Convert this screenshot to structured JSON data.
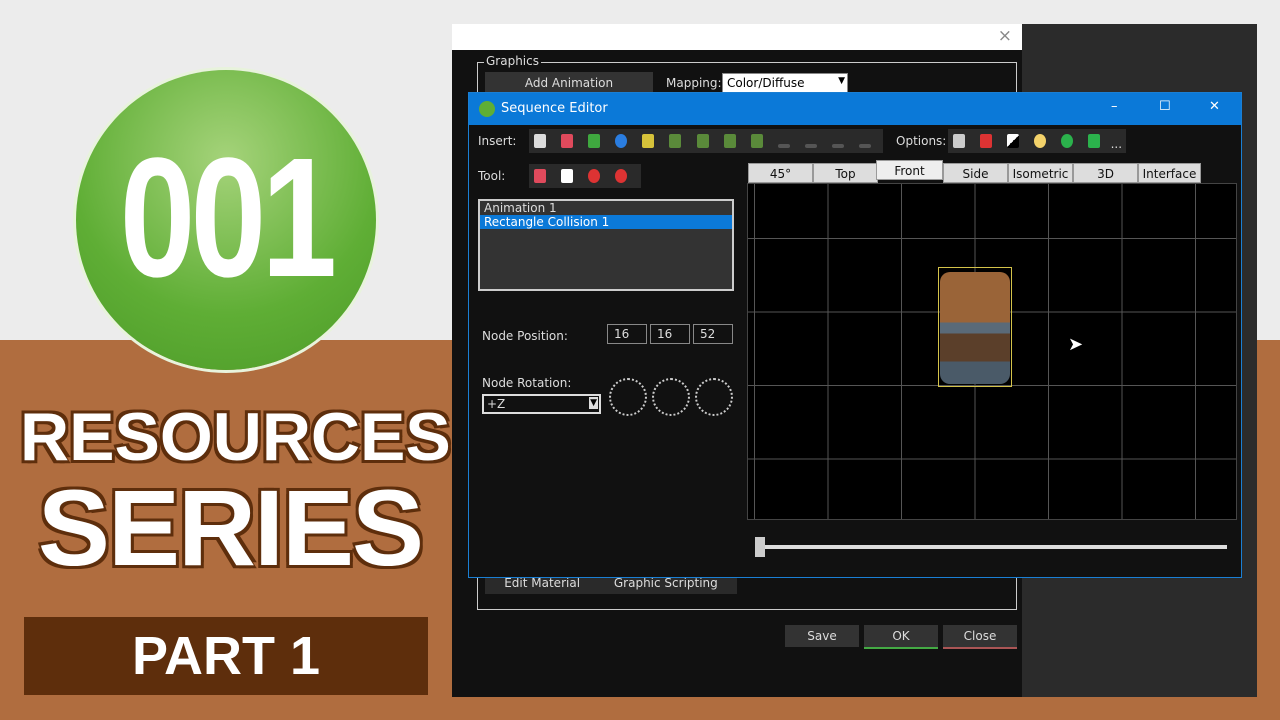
{
  "thumbnail": {
    "logo_text": "001",
    "line1": "RESOURCES",
    "line2": "SERIES",
    "part": "PART 1"
  },
  "background_dialog": {
    "close": "×",
    "group_label": "Graphics",
    "add_animation": "Add Animation",
    "mapping_label": "Mapping:",
    "mapping_value": "Color/Diffuse",
    "edit_material": "Edit Material",
    "graphic_scripting": "Graphic Scripting",
    "save": "Save",
    "ok": "OK",
    "close_btn": "Close"
  },
  "sequence_editor": {
    "title": "Sequence Editor",
    "minimize": "–",
    "maximize": "☐",
    "close": "✕",
    "insert_label": "Insert:",
    "options_label": "Options:",
    "options_more": "...",
    "tool_label": "Tool:",
    "tabs": [
      "45°",
      "Top",
      "Front",
      "Side",
      "Isometric",
      "3D",
      "Interface"
    ],
    "active_tab": "Front",
    "nodes": [
      "Animation 1",
      "Rectangle Collision 1"
    ],
    "selected_node": "Rectangle Collision 1",
    "node_position_label": "Node Position:",
    "node_position": [
      "16",
      "16",
      "52"
    ],
    "node_rotation_label": "Node Rotation:",
    "rotation_axis": "+Z",
    "timeline_position": 0
  },
  "colors": {
    "titlebar": "#0b79d8",
    "logo_green": "#5fae35",
    "brown": "#b06d3f",
    "dark_brown": "#5e2e0c"
  }
}
